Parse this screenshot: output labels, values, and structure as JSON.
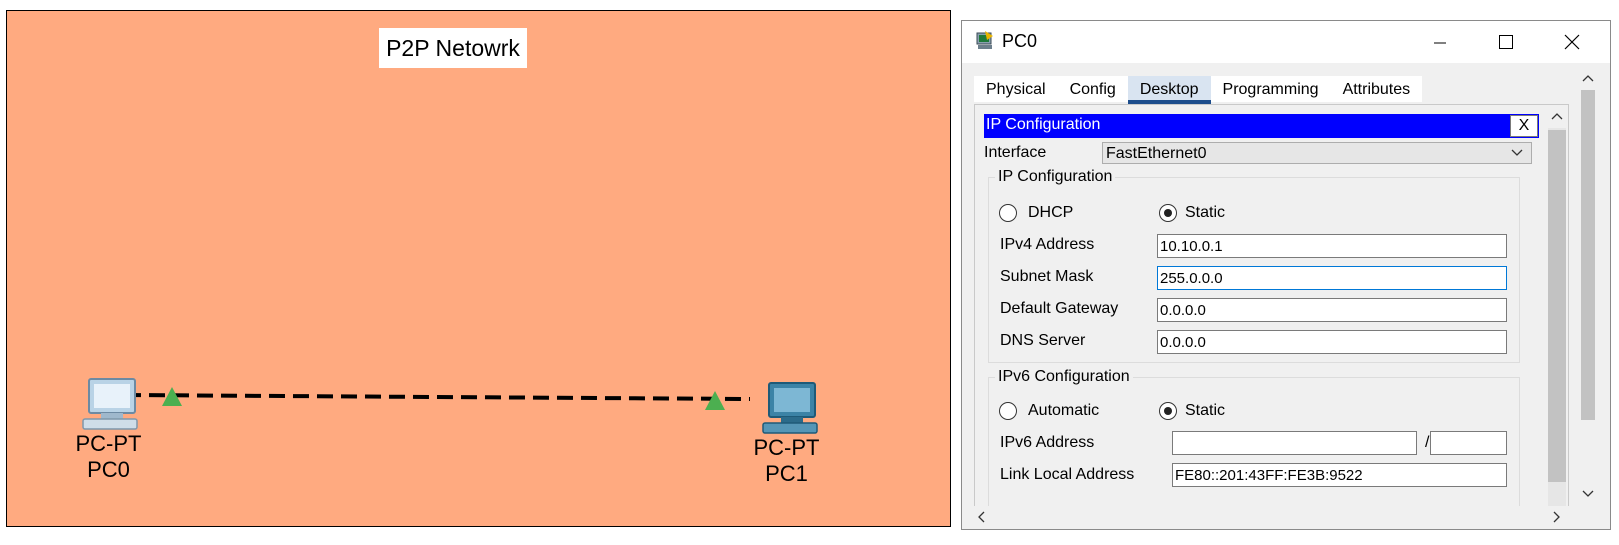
{
  "topology": {
    "title": "P2P Netowrk",
    "pc0": {
      "model": "PC-PT",
      "name": "PC0"
    },
    "pc1": {
      "model": "PC-PT",
      "name": "PC1"
    },
    "canvas_color": "#FFAA80",
    "link_status_color": "#4CAF50"
  },
  "window": {
    "title": "PC0",
    "tabs": [
      "Physical",
      "Config",
      "Desktop",
      "Programming",
      "Attributes"
    ],
    "active_tab": "Desktop"
  },
  "ip_config": {
    "header": "IP Configuration",
    "close_label": "X",
    "interface_label": "Interface",
    "interface_value": "FastEthernet0",
    "ipv4": {
      "group_title": "IP Configuration",
      "dhcp_label": "DHCP",
      "static_label": "Static",
      "mode": "Static",
      "ipv4_label": "IPv4 Address",
      "ipv4_value": "10.10.0.1",
      "mask_label": "Subnet Mask",
      "mask_value": "255.0.0.0",
      "gateway_label": "Default Gateway",
      "gateway_value": "0.0.0.0",
      "dns_label": "DNS Server",
      "dns_value": "0.0.0.0"
    },
    "ipv6": {
      "group_title": "IPv6 Configuration",
      "auto_label": "Automatic",
      "static_label": "Static",
      "mode": "Static",
      "address_label": "IPv6 Address",
      "address_value": "",
      "prefix_separator": "/",
      "prefix_value": "",
      "link_local_label": "Link Local Address",
      "link_local_value": "FE80::201:43FF:FE3B:9522"
    }
  },
  "colors": {
    "header_blue": "#0000FF",
    "tab_underline": "#1D4D8C"
  }
}
